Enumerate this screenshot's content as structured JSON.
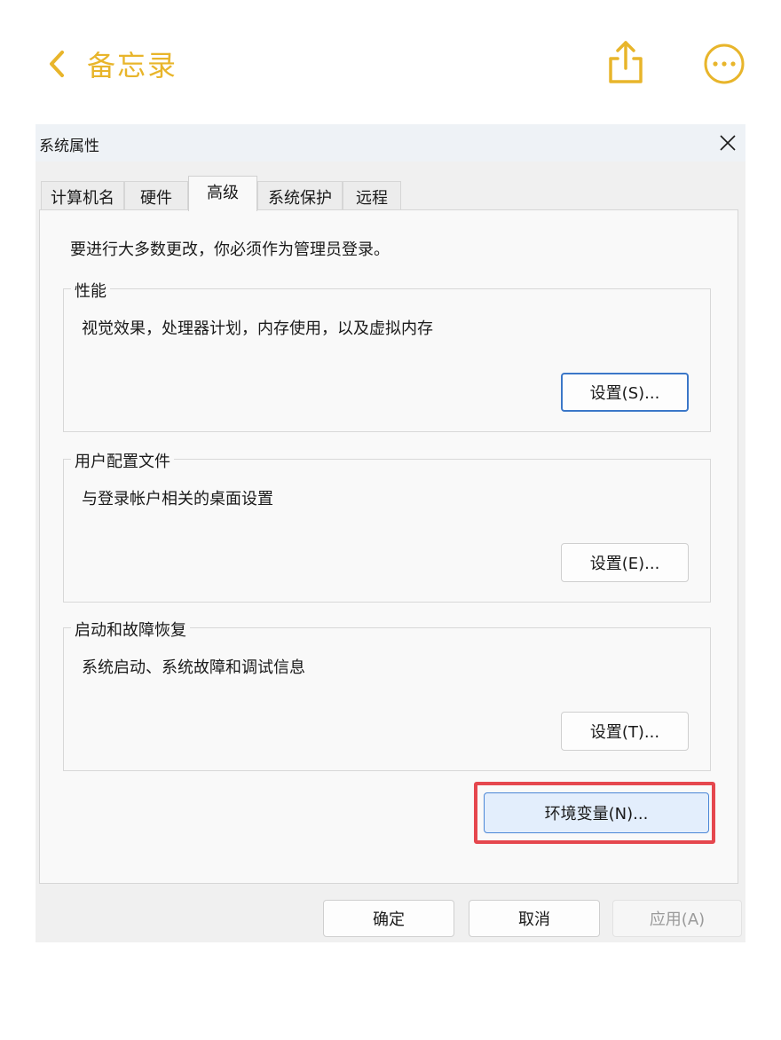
{
  "notes": {
    "back_label": "备忘录",
    "back_icon": "chevron-left-icon",
    "share_icon": "share-icon",
    "more_icon": "ellipsis-circle-icon",
    "accent_color": "#e8b52b"
  },
  "dialog": {
    "title": "系统属性",
    "close_icon": "close-icon",
    "tabs": [
      {
        "label": "计算机名",
        "active": false
      },
      {
        "label": "硬件",
        "active": false
      },
      {
        "label": "高级",
        "active": true
      },
      {
        "label": "系统保护",
        "active": false
      },
      {
        "label": "远程",
        "active": false
      }
    ],
    "notice": "要进行大多数更改，你必须作为管理员登录。",
    "groups": [
      {
        "title": "性能",
        "description": "视觉效果，处理器计划，内存使用，以及虚拟内存",
        "button": "设置(S)..."
      },
      {
        "title": "用户配置文件",
        "description": "与登录帐户相关的桌面设置",
        "button": "设置(E)..."
      },
      {
        "title": "启动和故障恢复",
        "description": "系统启动、系统故障和调试信息",
        "button": "设置(T)..."
      }
    ],
    "env_button": "环境变量(N)...",
    "footer": {
      "ok": "确定",
      "cancel": "取消",
      "apply": "应用(A)"
    },
    "highlight_color": "#e5474e"
  }
}
